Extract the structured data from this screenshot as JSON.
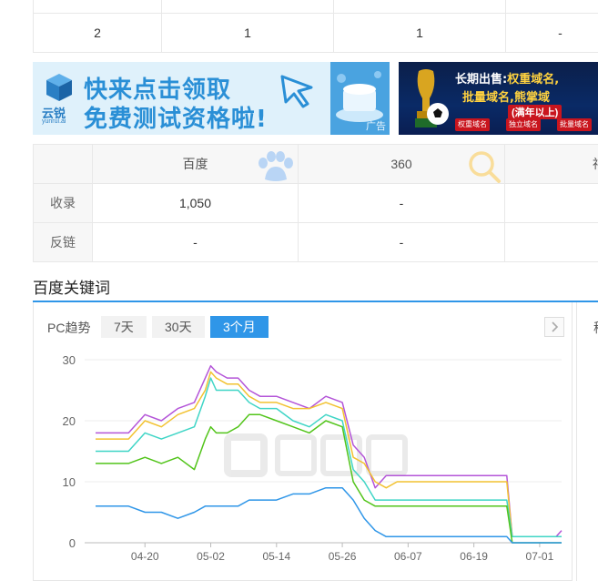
{
  "top_table": {
    "cells": [
      "2",
      "1",
      "1",
      "-"
    ]
  },
  "ad_yunrui": {
    "brand": "云锐",
    "brand_sub": "yunrui.ai",
    "line1": "快来点击领取",
    "line2": "免费测试资格啦!",
    "ad_tag": "广告"
  },
  "ad_domain": {
    "line1_a": "长期出售:",
    "line1_b": "权重域名,",
    "line2": "批量域名,熊掌域",
    "line3": "(满年以上)",
    "chip1": "权重域名",
    "chip2": "独立域名",
    "chip3": "批量域名"
  },
  "index_table": {
    "headers": [
      "百度",
      "360",
      "神"
    ],
    "rows": [
      {
        "label": "收录",
        "values": [
          "1,050",
          "-",
          ""
        ]
      },
      {
        "label": "反链",
        "values": [
          "-",
          "-",
          ""
        ]
      }
    ]
  },
  "section": {
    "title": "百度关键词"
  },
  "trend": {
    "label": "PC趋势",
    "ranges": [
      "7天",
      "30天",
      "3个月"
    ],
    "active_range": "3个月",
    "next_icon": "chevron-right-icon",
    "side_cut_label": "移"
  },
  "chart_data": {
    "type": "line",
    "ylim": [
      0,
      30
    ],
    "yticks": [
      0,
      10,
      20,
      30
    ],
    "xticks": [
      "04-20",
      "05-02",
      "05-14",
      "05-26",
      "06-07",
      "06-19",
      "07-01"
    ],
    "x": [
      "04-11",
      "04-14",
      "04-17",
      "04-20",
      "04-23",
      "04-26",
      "04-29",
      "05-01",
      "05-02",
      "05-03",
      "05-05",
      "05-07",
      "05-09",
      "05-11",
      "05-14",
      "05-17",
      "05-20",
      "05-23",
      "05-26",
      "05-28",
      "05-30",
      "06-01",
      "06-03",
      "06-05",
      "06-07",
      "06-10",
      "06-13",
      "06-16",
      "06-19",
      "06-22",
      "06-25",
      "06-26",
      "06-28",
      "07-01",
      "07-04",
      "07-05"
    ],
    "series": [
      {
        "color": "#b455d8",
        "values": [
          18,
          18,
          18,
          21,
          20,
          22,
          23,
          27,
          29,
          28,
          27,
          27,
          25,
          24,
          24,
          23,
          22,
          24,
          23,
          16,
          14,
          9,
          11,
          11,
          11,
          11,
          11,
          11,
          11,
          11,
          11,
          1,
          1,
          1,
          1,
          2
        ]
      },
      {
        "color": "#f2c230",
        "values": [
          17,
          17,
          17,
          20,
          19,
          21,
          22,
          25,
          28,
          27,
          26,
          26,
          24,
          23,
          23,
          22,
          22,
          23,
          22,
          14,
          13,
          10,
          9,
          10,
          10,
          10,
          10,
          10,
          10,
          10,
          10,
          1,
          1,
          1,
          1,
          1
        ]
      },
      {
        "color": "#3fd5c6",
        "values": [
          15,
          15,
          15,
          18,
          17,
          18,
          19,
          24,
          27,
          25,
          25,
          25,
          23,
          22,
          22,
          20,
          19,
          21,
          20,
          12,
          10,
          7,
          7,
          7,
          7,
          7,
          7,
          7,
          7,
          7,
          7,
          1,
          1,
          1,
          1,
          1
        ]
      },
      {
        "color": "#52c41a",
        "values": [
          13,
          13,
          13,
          14,
          13,
          14,
          12,
          17,
          19,
          18,
          18,
          19,
          21,
          21,
          20,
          19,
          18,
          20,
          19,
          10,
          7,
          6,
          6,
          6,
          6,
          6,
          6,
          6,
          6,
          6,
          6,
          0,
          0,
          0,
          0,
          0
        ]
      },
      {
        "color": "#2f96e8",
        "values": [
          6,
          6,
          6,
          5,
          5,
          4,
          5,
          6,
          6,
          6,
          6,
          6,
          7,
          7,
          7,
          8,
          8,
          9,
          9,
          7,
          4,
          2,
          1,
          1,
          1,
          1,
          1,
          1,
          1,
          1,
          1,
          0,
          0,
          0,
          0,
          0
        ]
      }
    ]
  }
}
